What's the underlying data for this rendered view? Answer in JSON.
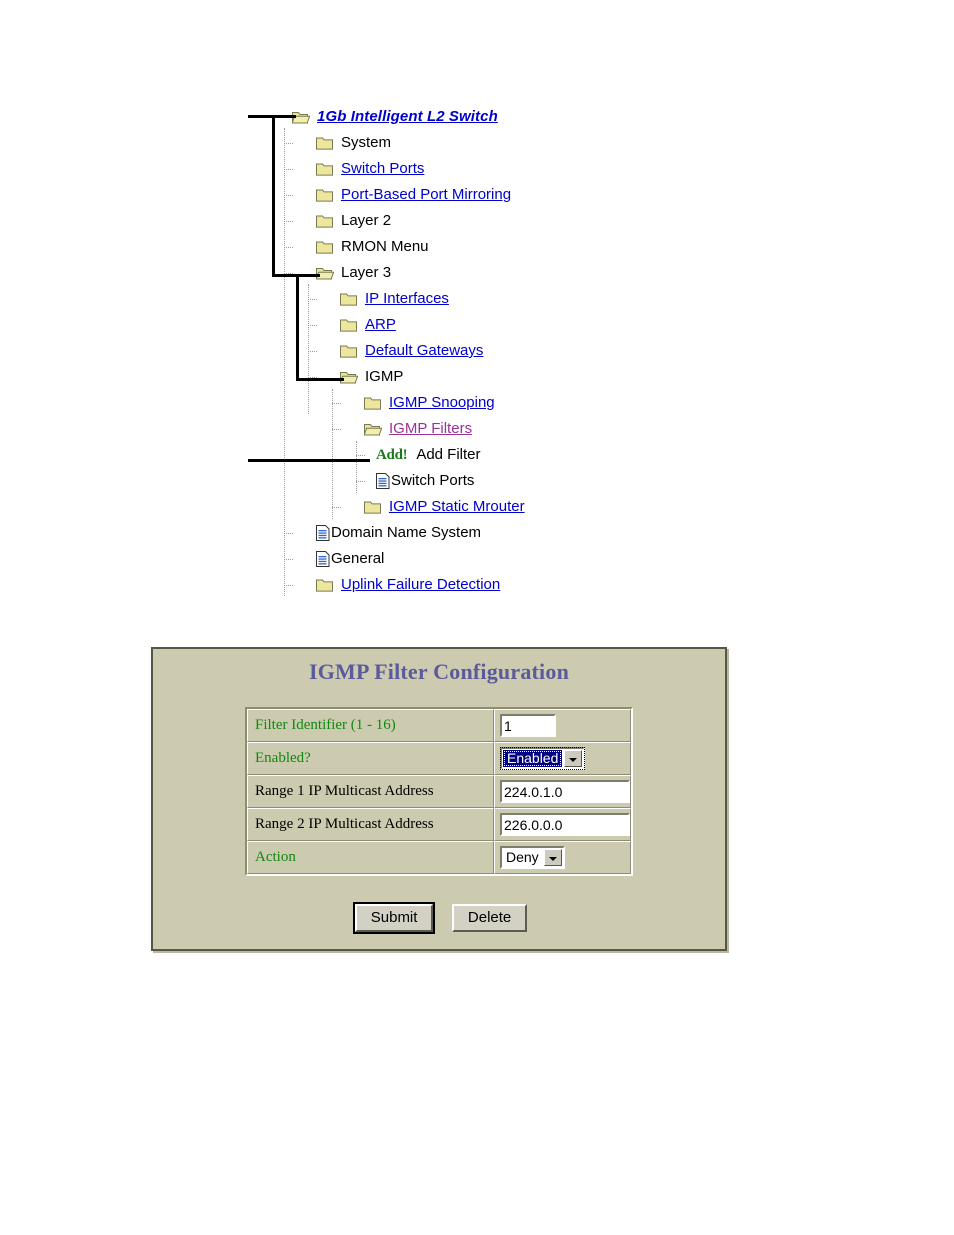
{
  "tree": {
    "root": {
      "label": "1Gb Intelligent L2 Switch",
      "icon": "open-folder-icon",
      "style": "root-link"
    },
    "items": [
      {
        "label": "System",
        "level": 1,
        "icon": "folder-icon",
        "style": "plain"
      },
      {
        "label": "Switch Ports",
        "level": 1,
        "icon": "folder-icon",
        "style": "link-blue"
      },
      {
        "label": "Port-Based Port Mirroring",
        "level": 1,
        "icon": "folder-icon",
        "style": "link-blue"
      },
      {
        "label": "Layer 2",
        "level": 1,
        "icon": "folder-icon",
        "style": "plain"
      },
      {
        "label": "RMON Menu",
        "level": 1,
        "icon": "folder-icon",
        "style": "plain"
      },
      {
        "label": "Layer 3",
        "level": 1,
        "icon": "open-folder-icon",
        "style": "plain"
      },
      {
        "label": "IP Interfaces",
        "level": 2,
        "icon": "folder-icon",
        "style": "link-blue"
      },
      {
        "label": "ARP",
        "level": 2,
        "icon": "folder-icon",
        "style": "link-blue"
      },
      {
        "label": "Default Gateways",
        "level": 2,
        "icon": "folder-icon",
        "style": "link-blue"
      },
      {
        "label": "IGMP",
        "level": 2,
        "icon": "open-folder-icon",
        "style": "plain"
      },
      {
        "label": "IGMP Snooping",
        "level": 3,
        "icon": "folder-icon",
        "style": "link-blue"
      },
      {
        "label": "IGMP Filters",
        "level": 3,
        "icon": "open-folder-icon",
        "style": "link-magenta"
      },
      {
        "label": "Add Filter",
        "level": 4,
        "icon": "add-bang-icon",
        "style": "plain",
        "prefix": "Add!"
      },
      {
        "label": "Switch Ports",
        "level": 4,
        "icon": "document-icon",
        "style": "plain-tight"
      },
      {
        "label": "IGMP Static Mrouter",
        "level": 3,
        "icon": "folder-icon",
        "style": "link-blue"
      },
      {
        "label": "Domain Name System",
        "level": 1,
        "icon": "document-icon",
        "style": "plain-tight"
      },
      {
        "label": "General",
        "level": 1,
        "icon": "document-icon",
        "style": "plain-tight"
      },
      {
        "label": "Uplink Failure Detection",
        "level": 1,
        "icon": "folder-icon",
        "style": "link-blue"
      }
    ]
  },
  "panel": {
    "title": "IGMP Filter Configuration",
    "rows": [
      {
        "label": "Filter Identifier (1 - 16)",
        "label_color": "green",
        "control": "text",
        "value": "1",
        "width": "small"
      },
      {
        "label": "Enabled?",
        "label_color": "green",
        "control": "select",
        "value": "Enabled",
        "focused": true
      },
      {
        "label": "Range 1 IP Multicast Address",
        "label_color": "black",
        "control": "text",
        "value": "224.0.1.0",
        "width": "wide"
      },
      {
        "label": "Range 2 IP Multicast Address",
        "label_color": "black",
        "control": "text",
        "value": "226.0.0.0",
        "width": "wide"
      },
      {
        "label": "Action",
        "label_color": "green",
        "control": "select",
        "value": "Deny",
        "focused": false
      }
    ],
    "buttons": {
      "submit": "Submit",
      "delete": "Delete"
    }
  },
  "colors": {
    "panel_bg": "#cdcbaf",
    "panel_border": "#565647",
    "title": "#5a5a9c",
    "label_green": "#118811",
    "link_blue": "#0000cc",
    "link_visited": "#993399",
    "select_focus": "#000080"
  }
}
